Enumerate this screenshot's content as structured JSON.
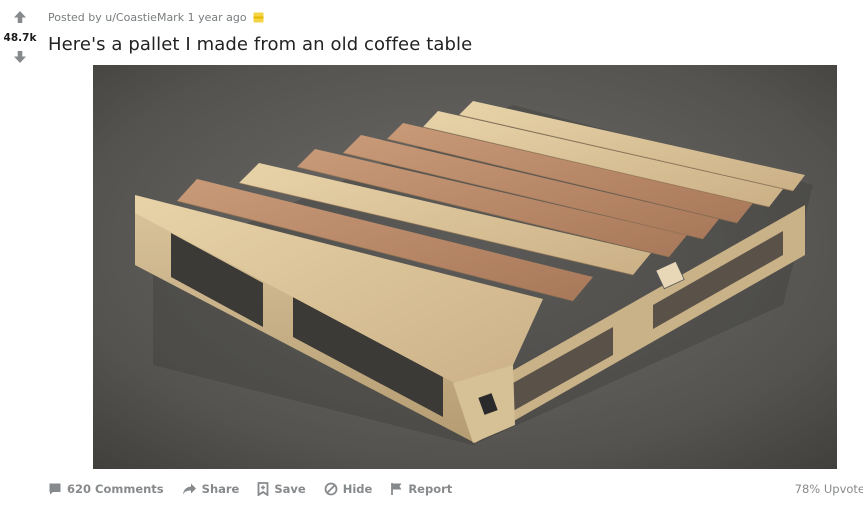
{
  "vote": {
    "score": "48.7k",
    "upvote_icon": "arrow-up-icon",
    "downvote_icon": "arrow-down-icon"
  },
  "post": {
    "meta": "Posted by u/CoastieMark 1 year ago",
    "title": "Here's a pallet I made from an old coffee table",
    "award_icon": "award-icon"
  },
  "actions": {
    "comments": "620 Comments",
    "share": "Share",
    "save": "Save",
    "hide": "Hide",
    "report": "Report",
    "upvoted": "78% Upvote"
  },
  "colors": {
    "meta": "#787c7e",
    "action": "#878a8c",
    "award": "#f4d444"
  }
}
